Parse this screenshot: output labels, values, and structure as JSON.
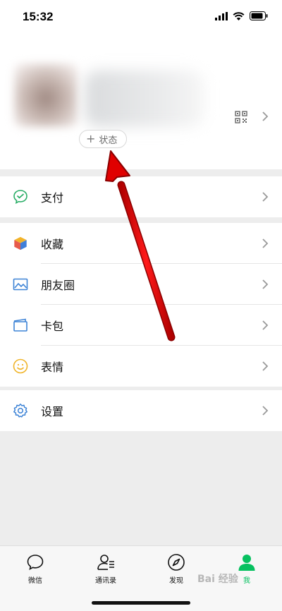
{
  "status_bar": {
    "time": "15:32"
  },
  "profile": {
    "status_button_label": "状态",
    "status_button_plus": "+"
  },
  "menu": {
    "pay": "支付",
    "favorites": "收藏",
    "moments": "朋友圈",
    "cards": "卡包",
    "stickers": "表情",
    "settings": "设置"
  },
  "tabbar": {
    "chats": "微信",
    "contacts": "通讯录",
    "discover": "发现",
    "me": "我"
  },
  "watermark": "Bai 经验",
  "colors": {
    "accent_green": "#07c160",
    "arrow_red": "#e00000"
  }
}
